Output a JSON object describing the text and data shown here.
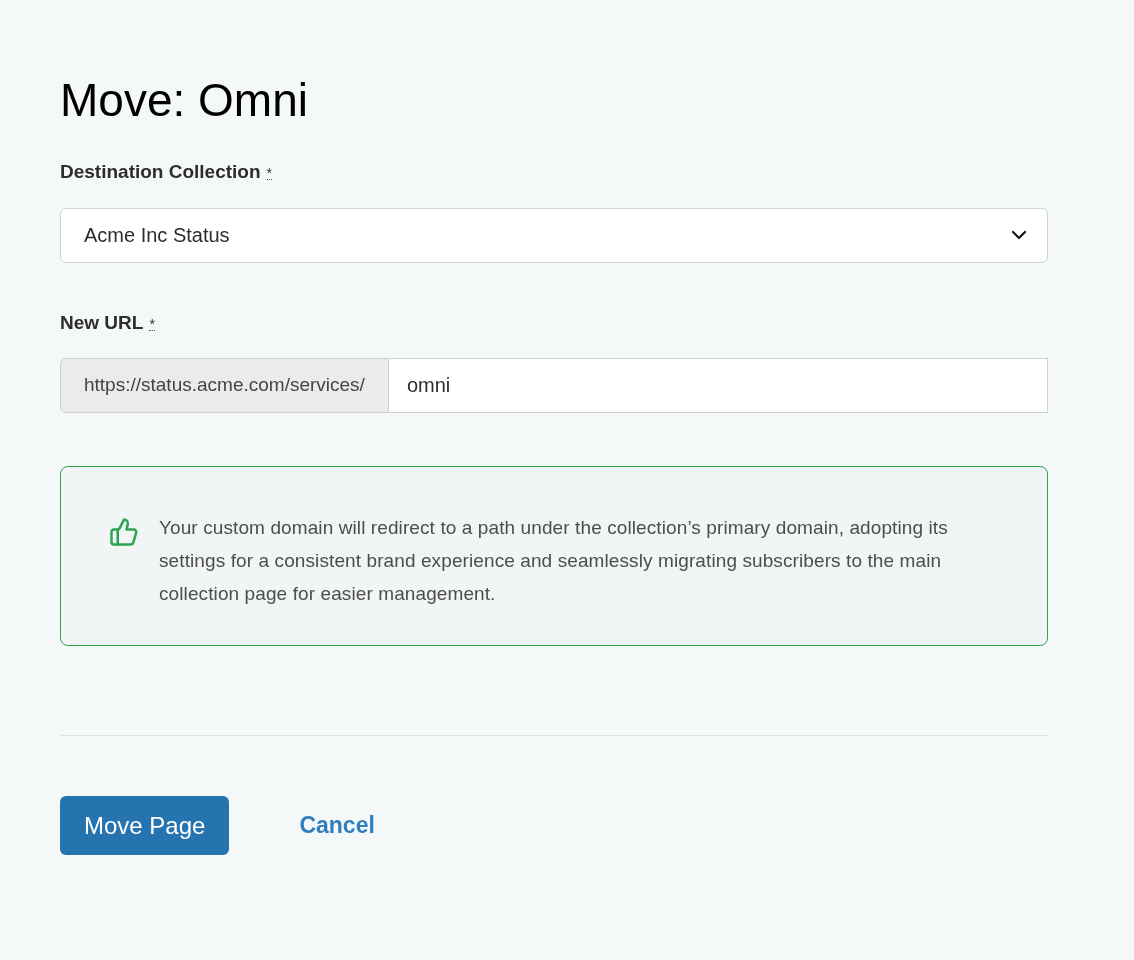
{
  "title": "Move: Omni",
  "destination": {
    "label": "Destination Collection",
    "required_mark": "*",
    "value": "Acme Inc Status"
  },
  "new_url": {
    "label": "New URL",
    "required_mark": "*",
    "prefix": "https://status.acme.com/services/",
    "value": "omni"
  },
  "notice": {
    "text": "Your custom domain will redirect to a path under the collection’s primary domain, adopting its settings for a consistent brand experience and seamlessly migrating subscribers to the main collection page for easier management."
  },
  "actions": {
    "primary": "Move Page",
    "cancel": "Cancel"
  }
}
